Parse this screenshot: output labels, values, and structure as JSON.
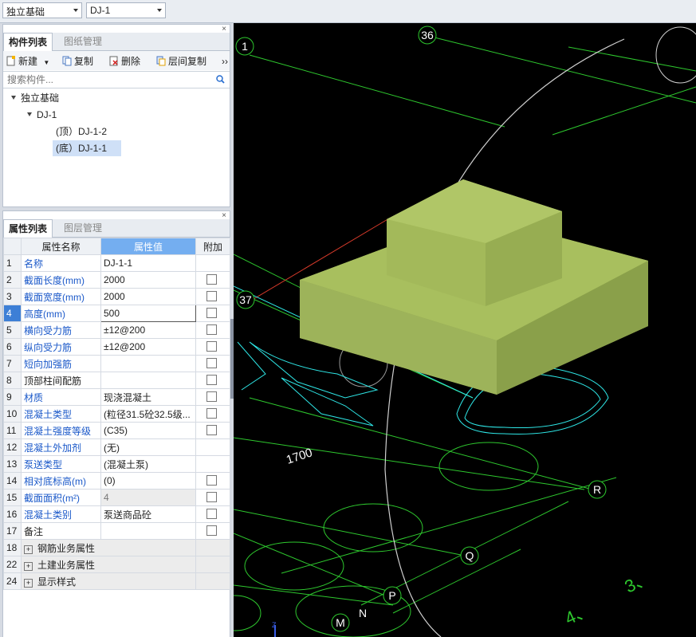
{
  "top": {
    "category_select": "独立基础",
    "component_select": "DJ-1"
  },
  "component_panel": {
    "tabs": [
      "构件列表",
      "图纸管理"
    ],
    "close": "×",
    "toolbar": {
      "new_label": "新建",
      "copy_label": "复制",
      "delete_label": "删除",
      "floor_copy_label": "层间复制",
      "more": "››"
    },
    "search_placeholder": "搜索构件...",
    "tree": {
      "root": "独立基础",
      "group": "DJ-1",
      "children": [
        "(顶）DJ-1-2",
        "(底）DJ-1-1"
      ]
    }
  },
  "property_panel": {
    "tabs": [
      "属性列表",
      "图层管理"
    ],
    "close": "×",
    "headers": [
      "属性名称",
      "属性值",
      "附加"
    ],
    "rows": [
      {
        "idx": "1",
        "name": "名称",
        "value": "DJ-1-1",
        "blue": true,
        "check": false
      },
      {
        "idx": "2",
        "name": "截面长度(mm)",
        "value": "2000",
        "blue": true,
        "check": true
      },
      {
        "idx": "3",
        "name": "截面宽度(mm)",
        "value": "2000",
        "blue": true,
        "check": true
      },
      {
        "idx": "4",
        "name": "高度(mm)",
        "value": "500",
        "blue": true,
        "check": true
      },
      {
        "idx": "5",
        "name": "横向受力筋",
        "value": "±12@200",
        "blue": true,
        "check": true
      },
      {
        "idx": "6",
        "name": "纵向受力筋",
        "value": "±12@200",
        "blue": true,
        "check": true
      },
      {
        "idx": "7",
        "name": "短向加强筋",
        "value": "",
        "blue": true,
        "check": true
      },
      {
        "idx": "8",
        "name": "顶部柱间配筋",
        "value": "",
        "blue": false,
        "check": true
      },
      {
        "idx": "9",
        "name": "材质",
        "value": "现浇混凝土",
        "blue": true,
        "check": true
      },
      {
        "idx": "10",
        "name": "混凝土类型",
        "value": "(粒径31.5砼32.5级...",
        "blue": true,
        "check": true
      },
      {
        "idx": "11",
        "name": "混凝土强度等级",
        "value": "(C35)",
        "blue": true,
        "check": true
      },
      {
        "idx": "12",
        "name": "混凝土外加剂",
        "value": "(无)",
        "blue": true,
        "check": false
      },
      {
        "idx": "13",
        "name": "泵送类型",
        "value": "(混凝土泵)",
        "blue": true,
        "check": false
      },
      {
        "idx": "14",
        "name": "相对底标高(m)",
        "value": "(0)",
        "blue": true,
        "check": true
      },
      {
        "idx": "15",
        "name": "截面面积(m²)",
        "value": "4",
        "blue": true,
        "check": true
      },
      {
        "idx": "16",
        "name": "混凝土类别",
        "value": "泵送商品砼",
        "blue": true,
        "check": true
      },
      {
        "idx": "17",
        "name": "备注",
        "value": "",
        "blue": false,
        "check": true
      }
    ],
    "groups": [
      {
        "idx": "18",
        "name": "钢筋业务属性"
      },
      {
        "idx": "22",
        "name": "土建业务属性"
      },
      {
        "idx": "24",
        "name": "显示样式"
      }
    ]
  },
  "canvas": {
    "axis_labels": [
      "1",
      "36",
      "37",
      "R",
      "Q",
      "P",
      "M",
      "N"
    ],
    "dimension_text": "1700",
    "bottom_text_1": "3、",
    "bottom_text_2": "4、",
    "foundation_color": "#9db35a"
  }
}
